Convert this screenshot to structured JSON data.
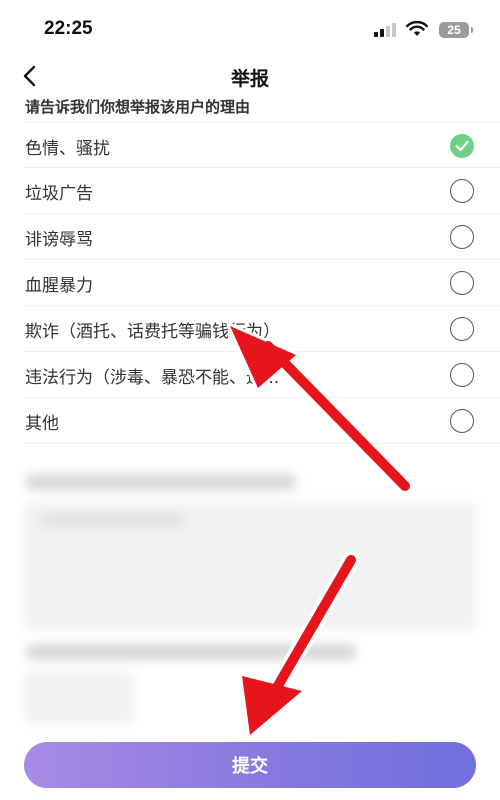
{
  "status_bar": {
    "time": "22:25",
    "battery_level": "25",
    "icons": [
      "signal-icon",
      "wifi-icon",
      "battery-icon"
    ]
  },
  "header": {
    "title": "举报",
    "back_icon": "chevron-left-icon"
  },
  "prompt": "请告诉我们你想举报该用户的理由",
  "reasons": [
    {
      "label": "色情、骚扰",
      "checked": true
    },
    {
      "label": "垃圾广告",
      "checked": false
    },
    {
      "label": "诽谤辱骂",
      "checked": false
    },
    {
      "label": "血腥暴力",
      "checked": false
    },
    {
      "label": "欺诈（酒托、话费托等骗钱行为）",
      "checked": false
    },
    {
      "label": "违法行为（涉毒、暴恐不能、违...",
      "checked": false
    },
    {
      "label": "其他",
      "checked": false
    }
  ],
  "submit_label": "提交",
  "colors": {
    "checked_green": "#6ecf85",
    "button_gradient_start": "#a98be6",
    "button_gradient_end": "#6f6fde",
    "annotation_arrow": "#e8141c"
  }
}
